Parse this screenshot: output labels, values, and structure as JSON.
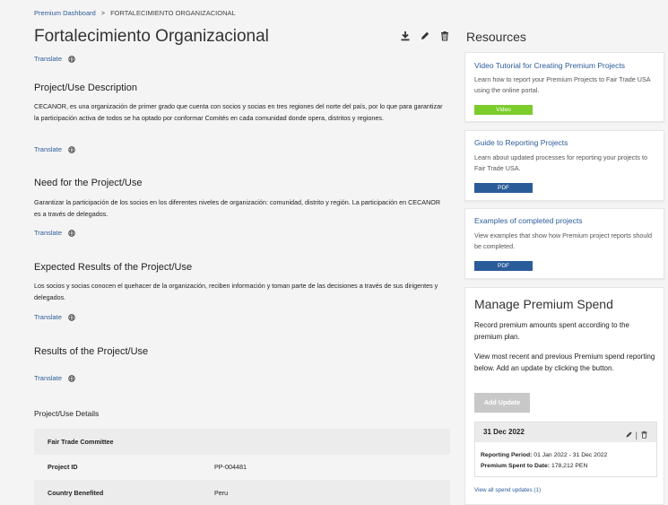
{
  "breadcrumb": {
    "home": "Premium Dashboard",
    "separator": ">",
    "current": "FORTALECIMIENTO ORGANIZACIONAL"
  },
  "page": {
    "title": "Fortalecimiento Organizacional",
    "translate_label": "Translate"
  },
  "sections": [
    {
      "title": "Project/Use Description",
      "text": "CECANOR, es una organización de primer grado que cuenta con socios y socias en tres regiones del norte del país, por lo que para garantizar la participación activa de todos se ha optado por conformar Comités en cada comunidad donde opera, distritos y regiones."
    },
    {
      "title": "Need for the Project/Use",
      "text": "Garantizar la participación de los socios en los diferentes niveles de organización: comunidad, distrito y región. La participación en CECANOR es a través de delegados."
    },
    {
      "title": "Expected Results of the Project/Use",
      "text": "Los socios y socias conocen el quehacer de la organización, reciben información y toman parte de las decisiones a través de sus dirigentes y delegados."
    },
    {
      "title": "Results of the Project/Use",
      "text": ""
    }
  ],
  "details": {
    "title": "Project/Use Details",
    "rows": [
      {
        "label": "Fair Trade Committee",
        "value": ""
      },
      {
        "label": "Project ID",
        "value": "PP-004481"
      },
      {
        "label": "Country Benefited",
        "value": "Peru"
      }
    ]
  },
  "resources": {
    "title": "Resources",
    "cards": [
      {
        "title": "Video Tutorial for Creating Premium Projects",
        "desc": "Learn how to report your Premium Projects to Fair Trade USA using the online portal.",
        "button": "Video"
      },
      {
        "title": "Guide to Reporting Projects",
        "desc": "Learn about updated processes for reporting your projects to Fair Trade USA.",
        "button": "PDF"
      },
      {
        "title": "Examples of completed projects",
        "desc": "View examples that show how Premium project reports should be completed.",
        "button": "PDF"
      }
    ]
  },
  "manage": {
    "title": "Manage Premium Spend",
    "p1": "Record premium amounts spent according to the premium plan.",
    "p2": "View most recent and previous Premium spend reporting below. Add an update by clicking the button.",
    "add_button": "Add Update",
    "update": {
      "date": "31 Dec 2022",
      "period_label": "Reporting Period:",
      "period_value": "01 Jan 2022 - 31 Dec 2022",
      "spent_label": "Premium Spent to Date:",
      "spent_value": "178,212 PEN",
      "separator": "|"
    },
    "view_all": "View all spend updates (1)"
  },
  "colors": {
    "link": "#2b5c9a",
    "video": "#7ccc2b",
    "pdf": "#2b5c9a",
    "disabled": "#c8c8c8"
  },
  "icons": [
    "download-icon",
    "pencil-icon",
    "trash-icon",
    "globe-icon"
  ]
}
